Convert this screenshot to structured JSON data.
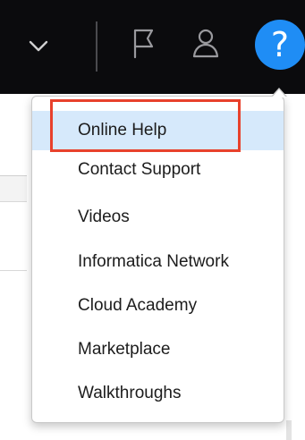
{
  "header": {
    "icons": {
      "chevron": "chevron-down-icon",
      "flag": "flag-icon",
      "user": "user-icon",
      "help": "help-icon"
    },
    "help_symbol": "?"
  },
  "help_menu": {
    "items": [
      {
        "label": "Online Help",
        "active": true
      },
      {
        "label": "Contact Support"
      },
      {
        "label": "Videos"
      },
      {
        "label": "Informatica Network"
      },
      {
        "label": "Cloud Academy"
      },
      {
        "label": "Marketplace"
      },
      {
        "label": "Walkthroughs"
      }
    ]
  },
  "colors": {
    "header_bg": "#0b0b0d",
    "help_button": "#1f8df5",
    "active_item_bg": "#d6e9fb",
    "callout_border": "#e8412c"
  }
}
